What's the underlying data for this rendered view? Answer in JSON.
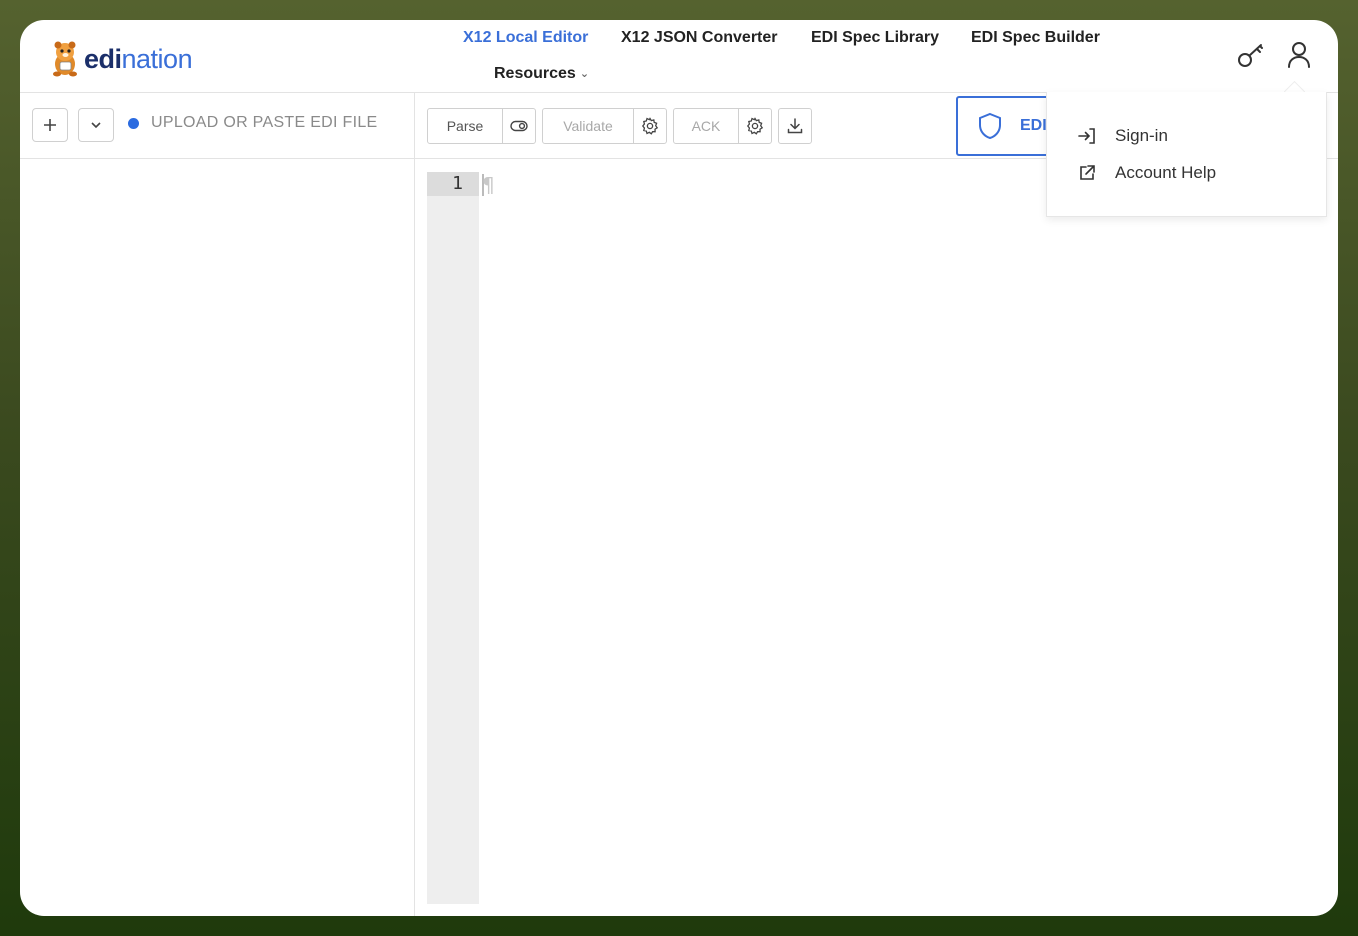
{
  "brand": {
    "name_bold": "edi",
    "name_rest": "nation"
  },
  "nav": {
    "items": [
      {
        "label": "X12 Local Editor",
        "active": true
      },
      {
        "label": "X12 JSON Converter",
        "active": false
      },
      {
        "label": "EDI Spec Library",
        "active": false
      },
      {
        "label": "EDI Spec Builder",
        "active": false
      }
    ],
    "resources_label": "Resources"
  },
  "header_icons": [
    "key-icon",
    "user-icon"
  ],
  "toolbar": {
    "upload_label": "UPLOAD OR PASTE EDI FILE",
    "parse_label": "Parse",
    "validate_label": "Validate",
    "ack_label": "ACK",
    "edi_button_label": "EDI"
  },
  "editor": {
    "line_number": "1",
    "pilcrow": "¶"
  },
  "account_menu": {
    "items": [
      {
        "label": "Sign-in",
        "icon": "sign-in-icon"
      },
      {
        "label": "Account Help",
        "icon": "external-link-icon"
      }
    ]
  },
  "colors": {
    "accent": "#3a6fd8",
    "status_dot": "#2b6be0",
    "brand_dark": "#1b2f6a"
  }
}
